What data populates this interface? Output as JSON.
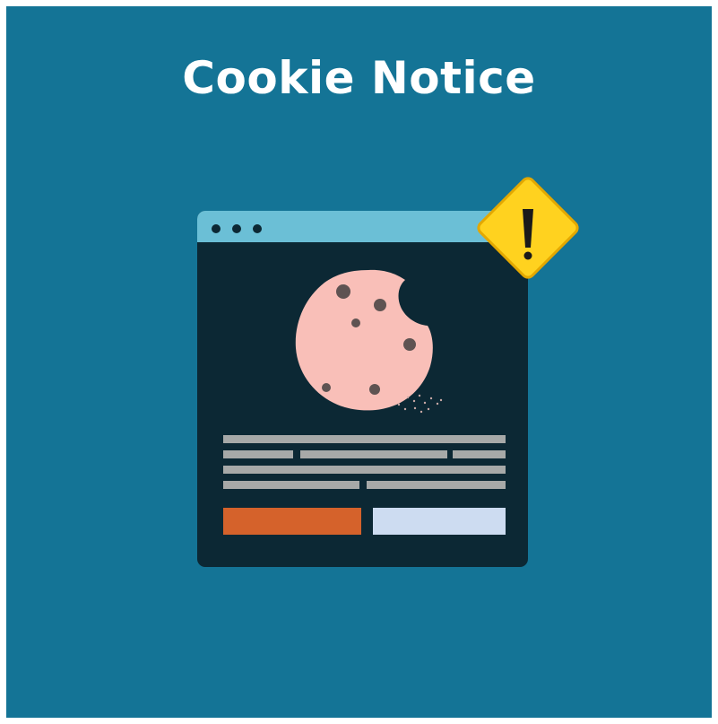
{
  "page": {
    "title": "Cookie Notice"
  },
  "colors": {
    "background": "#147496",
    "window_body": "#0c2834",
    "window_titlebar": "#6bbfd6",
    "cookie": "#f9bfb8",
    "cookie_chips": "#5f5352",
    "text_lines": "#a7a9a8",
    "accept_button": "#d5622b",
    "decline_button": "#cddcf1",
    "warning_fill": "#ffd21f",
    "warning_border": "#e3a800"
  },
  "icons": {
    "browser": "browser-window-icon",
    "cookie": "cookie-icon",
    "warning": "warning-icon"
  }
}
